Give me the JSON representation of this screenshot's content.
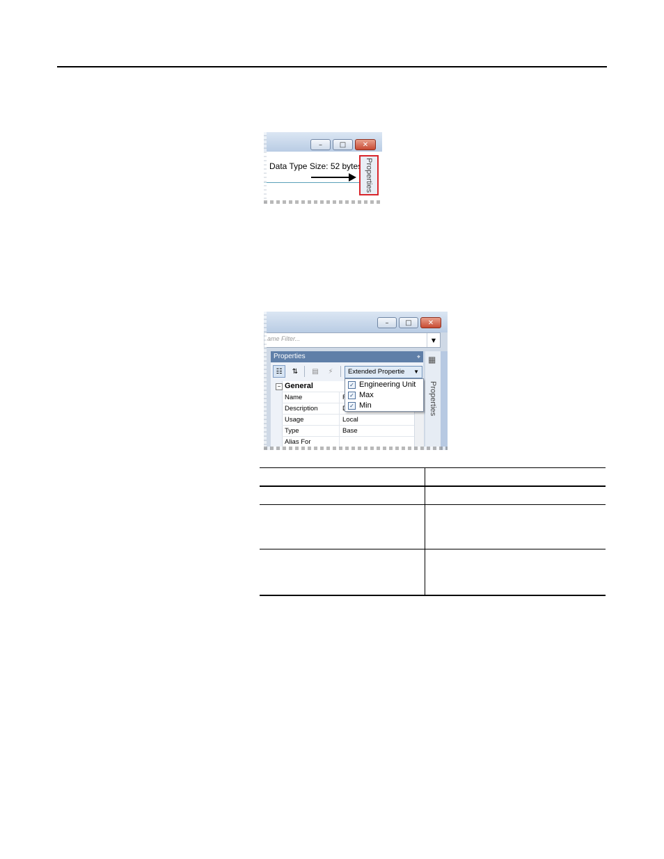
{
  "screenshot1": {
    "size_label": "Data Type Size: 52 bytes",
    "properties_tab": "Properties",
    "window_buttons": {
      "minimize": "–",
      "restore": "□",
      "close": "✕"
    }
  },
  "screenshot2": {
    "filter_placeholder": "ame Filter...",
    "panel_title": "Properties",
    "pin_glyph": "⌖",
    "view_selector": "Extended Propertie",
    "dropdown_options": [
      {
        "label": "Engineering Unit",
        "checked": true
      },
      {
        "label": "Max",
        "checked": true
      },
      {
        "label": "Min",
        "checked": true
      }
    ],
    "group_label": "General",
    "rows": [
      {
        "name": "Name",
        "value": "F"
      },
      {
        "name": "Description",
        "value": "D"
      },
      {
        "name": "Usage",
        "value": "Local"
      },
      {
        "name": "Type",
        "value": "Base"
      },
      {
        "name": "Alias For",
        "value": ""
      }
    ],
    "properties_tab": "Properties",
    "window_buttons": {
      "minimize": "–",
      "restore": "□",
      "close": "✕"
    }
  }
}
